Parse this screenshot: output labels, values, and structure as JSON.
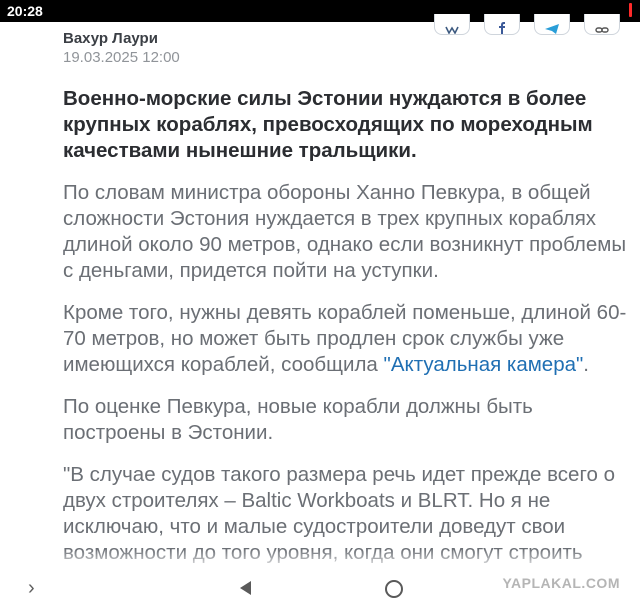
{
  "status_bar": {
    "time": "20:28"
  },
  "share_buttons": [
    {
      "icon": "vk-icon"
    },
    {
      "icon": "facebook-icon"
    },
    {
      "icon": "telegram-icon"
    },
    {
      "icon": "link-icon"
    }
  ],
  "article": {
    "author": "Вахур Лаури",
    "date": "19.03.2025 12:00",
    "lead": "Военно-морские силы Эстонии нуждаются в более крупных кораблях, превосходящих по мореходным качествами нынешние тральщики.",
    "p1": "По словам министра обороны Ханно Певкура, в общей сложности Эстония нуждается в трех крупных кораблях длиной около 90 метров, однако если возникнут проблемы с деньгами, придется пойти на уступки.",
    "p2_text": "Кроме того, нужны девять кораблей поменьше, длиной 60-70 метров, но может быть продлен срок службы уже имеющихся кораблей, сообщила ",
    "p2_link": "\"Актуальная камера\"",
    "p2_end": ".",
    "p3": "По оценке Певкура, новые корабли должны быть построены в Эстонии.",
    "p4": "\"В случае судов такого размера речь идет прежде всего о двух строителях – Baltic Workboats и BLRT. Но я не исключаю, что и малые судостроители доведут свои возможности до того уровня, когда они смогут строить"
  },
  "nav_bar": {
    "watermark": "YAPLAKAL.COM"
  },
  "colors": {
    "link": "#1f6fb3",
    "lead_text": "#2b2d31",
    "body_text": "#6b6f75",
    "date_text": "#909499"
  }
}
